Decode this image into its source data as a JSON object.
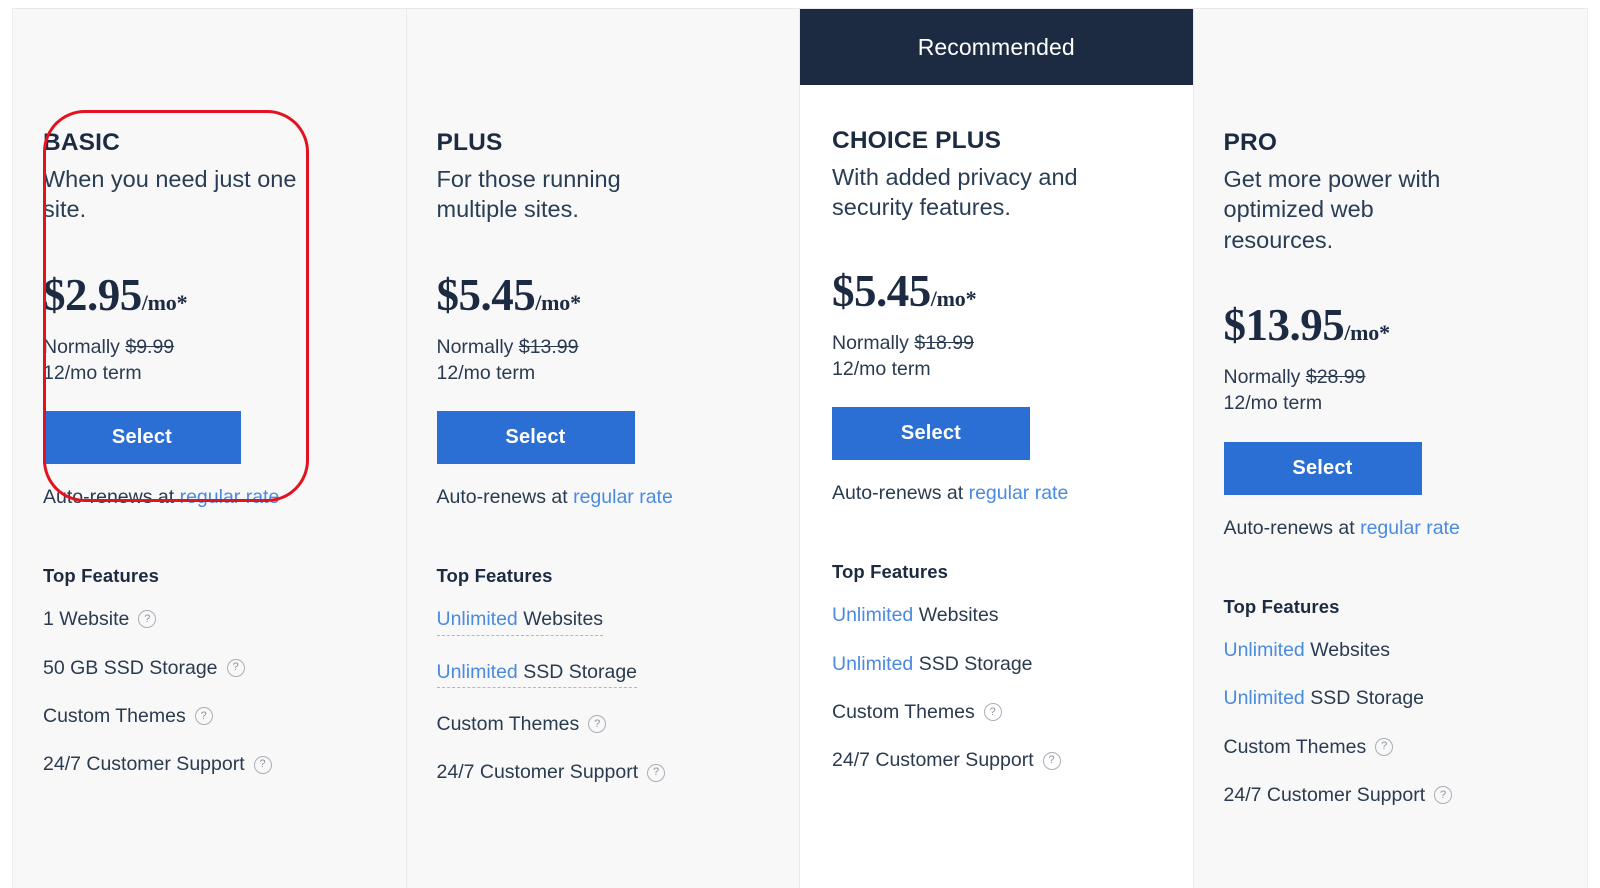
{
  "banner": {
    "recommended_label": "Recommended"
  },
  "annotation": {
    "color": "#e4121f",
    "target_plan": "BASIC"
  },
  "common": {
    "select_label": "Select",
    "autorenew_prefix": "Auto-renews at",
    "autorenew_link": "regular rate",
    "features_heading": "Top Features",
    "normally_prefix": "Normally",
    "term": "12/mo term",
    "per_month": "/mo*",
    "help_icon": "question-circle-icon"
  },
  "plans": [
    {
      "id": "basic",
      "name": "BASIC",
      "tagline": "When you need just one site.",
      "price": "$2.95",
      "per": "/mo*",
      "normally_prefix": "Normally",
      "was": "$9.99",
      "term": "12/mo term",
      "select_label": "Select",
      "autorenew_prefix": "Auto-renews at",
      "autorenew_link": "regular rate",
      "features_heading": "Top Features",
      "recommended": false,
      "features": [
        {
          "highlight": "",
          "text": "1 Website",
          "help": true,
          "dashed": false
        },
        {
          "highlight": "",
          "text": "50 GB SSD Storage",
          "help": true,
          "dashed": false
        },
        {
          "highlight": "",
          "text": "Custom Themes",
          "help": true,
          "dashed": false
        },
        {
          "highlight": "",
          "text": "24/7 Customer Support",
          "help": true,
          "dashed": false
        }
      ]
    },
    {
      "id": "plus",
      "name": "PLUS",
      "tagline": "For those running multiple sites.",
      "price": "$5.45",
      "per": "/mo*",
      "normally_prefix": "Normally",
      "was": "$13.99",
      "term": "12/mo term",
      "select_label": "Select",
      "autorenew_prefix": "Auto-renews at",
      "autorenew_link": "regular rate",
      "features_heading": "Top Features",
      "recommended": false,
      "features": [
        {
          "highlight": "Unlimited",
          "text": " Websites",
          "help": false,
          "dashed": true
        },
        {
          "highlight": "Unlimited",
          "text": " SSD Storage",
          "help": false,
          "dashed": true
        },
        {
          "highlight": "",
          "text": "Custom Themes",
          "help": true,
          "dashed": false
        },
        {
          "highlight": "",
          "text": "24/7 Customer Support",
          "help": true,
          "dashed": false
        }
      ]
    },
    {
      "id": "choice-plus",
      "name": "CHOICE PLUS",
      "tagline": "With added privacy and security features.",
      "price": "$5.45",
      "per": "/mo*",
      "normally_prefix": "Normally",
      "was": "$18.99",
      "term": "12/mo term",
      "select_label": "Select",
      "autorenew_prefix": "Auto-renews at",
      "autorenew_link": "regular rate",
      "features_heading": "Top Features",
      "recommended": true,
      "features": [
        {
          "highlight": "Unlimited",
          "text": " Websites",
          "help": false,
          "dashed": false
        },
        {
          "highlight": "Unlimited",
          "text": " SSD Storage",
          "help": false,
          "dashed": false
        },
        {
          "highlight": "",
          "text": "Custom Themes",
          "help": true,
          "dashed": false
        },
        {
          "highlight": "",
          "text": "24/7 Customer Support",
          "help": true,
          "dashed": false
        }
      ]
    },
    {
      "id": "pro",
      "name": "PRO",
      "tagline": "Get more power with optimized web resources.",
      "price": "$13.95",
      "per": "/mo*",
      "normally_prefix": "Normally",
      "was": "$28.99",
      "term": "12/mo term",
      "select_label": "Select",
      "autorenew_prefix": "Auto-renews at",
      "autorenew_link": "regular rate",
      "features_heading": "Top Features",
      "recommended": false,
      "features": [
        {
          "highlight": "Unlimited",
          "text": " Websites",
          "help": false,
          "dashed": false
        },
        {
          "highlight": "Unlimited",
          "text": " SSD Storage",
          "help": false,
          "dashed": false
        },
        {
          "highlight": "",
          "text": "Custom Themes",
          "help": true,
          "dashed": false
        },
        {
          "highlight": "",
          "text": "24/7 Customer Support",
          "help": true,
          "dashed": false
        }
      ]
    }
  ]
}
